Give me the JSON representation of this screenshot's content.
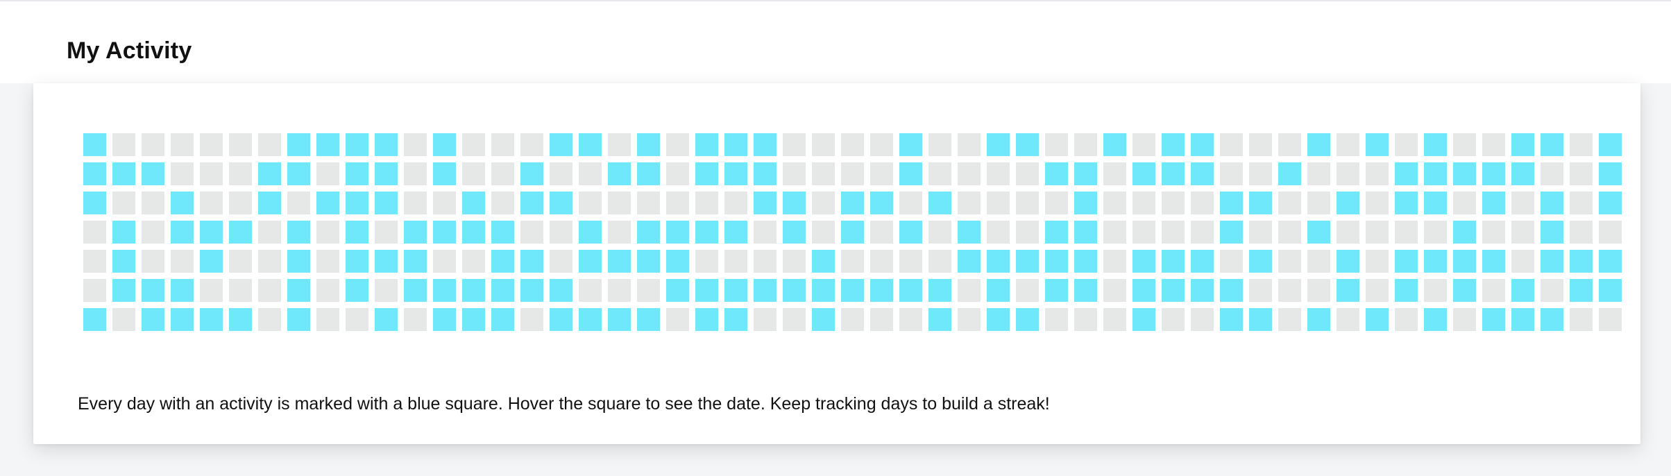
{
  "page": {
    "title": "My Activity"
  },
  "activity": {
    "active_color": "#6fe8fb",
    "inactive_color": "#e6e8e7",
    "rows": [
      "10000001111010001101011100001001100101100010101001101",
      "11100011011010010011011100001000011011100100011111001",
      "10010010111001011000000110110100001000011001011010101",
      "01011101010111100101111010101010011000010010000100100",
      "01001001011100110111100001000011111011101001011110111",
      "01110001010111111000111111111101011011110001010101011",
      "10111101001011101111011001000101100010011010101011100"
    ],
    "caption": "Every day with an activity is marked with a blue square. Hover the square to see the date. Keep tracking days to build a streak!"
  }
}
